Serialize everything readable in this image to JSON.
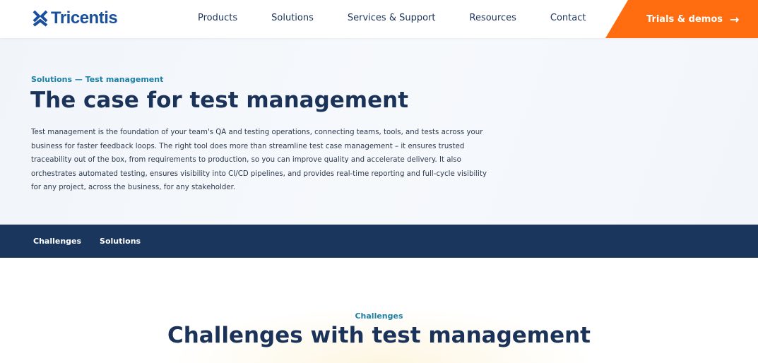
{
  "header": {
    "logo": "Tricentis",
    "nav": [
      "Products",
      "Solutions",
      "Services & Support",
      "Resources",
      "Contact"
    ],
    "cta": "Trials & demos"
  },
  "hero": {
    "eyebrow": "Solutions — Test management",
    "title": "The case for test management",
    "description": "Test management is the foundation of your team's QA and testing operations, connecting teams, tools, and tests across your business for faster feedback loops. The right tool does more than streamline test case management – it ensures trusted traceability out of the box, from requirements to production, so you can improve quality and accelerate delivery. It also orchestrates automated testing, ensures visibility into CI/CD pipelines, and provides real-time reporting and full-cycle visibility for any project, across the business, for any stakeholder."
  },
  "subnav": [
    "Challenges",
    "Solutions"
  ],
  "section": {
    "eyebrow": "Challenges",
    "title": "Challenges with test management"
  },
  "colors": {
    "brand": "#1a4f9c",
    "accent": "#ff6d10",
    "navy": "#1b365d"
  }
}
